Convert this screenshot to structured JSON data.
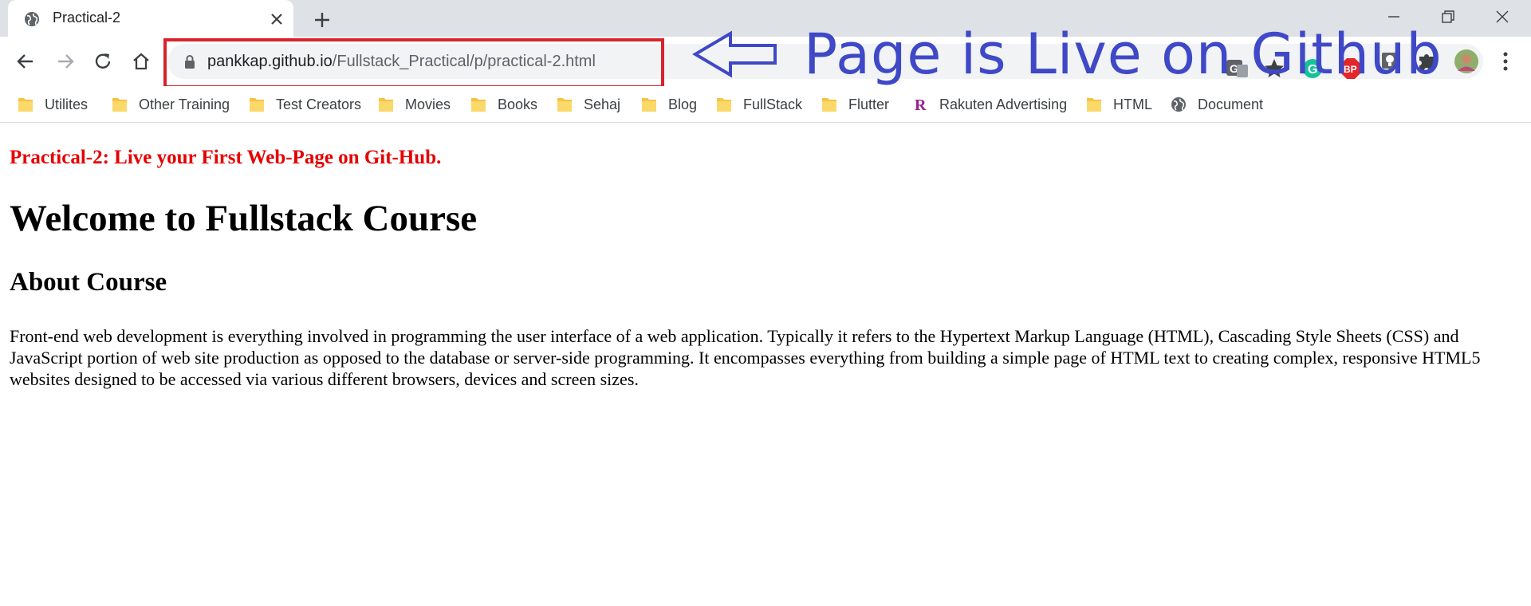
{
  "tab": {
    "title": "Practical-2"
  },
  "window": {
    "min_icon": "minimize-icon",
    "max_icon": "restore-icon",
    "close_icon": "close-icon"
  },
  "omnibox": {
    "host": "pankkap.github.io",
    "path": "/Fullstack_Practical/p/practical-2.html"
  },
  "annotation": {
    "text": "Page is Live on Github",
    "color": "#3f48c6",
    "box_color": "#d8232a"
  },
  "bookmarks": [
    {
      "label": "Utilites",
      "icon": "folder"
    },
    {
      "label": "Other Training",
      "icon": "folder"
    },
    {
      "label": "Test Creators",
      "icon": "folder"
    },
    {
      "label": "Movies",
      "icon": "folder"
    },
    {
      "label": "Books",
      "icon": "folder"
    },
    {
      "label": "Sehaj",
      "icon": "folder"
    },
    {
      "label": "Blog",
      "icon": "folder"
    },
    {
      "label": "FullStack",
      "icon": "folder"
    },
    {
      "label": "Flutter",
      "icon": "folder"
    },
    {
      "label": "Rakuten Advertising",
      "icon": "rakuten"
    },
    {
      "label": "HTML",
      "icon": "folder"
    },
    {
      "label": "Document",
      "icon": "globe"
    }
  ],
  "page": {
    "practical_title": "Practical-2: Live your First Web-Page on Git-Hub.",
    "heading": "Welcome to Fullstack Course",
    "subheading": "About Course",
    "paragraph": "Front-end web development is everything involved in programming the user interface of a web application. Typically it refers to the Hypertext Markup Language (HTML), Cascading Style Sheets (CSS) and JavaScript portion of web site production as opposed to the database or server-side programming. It encompasses everything from building a simple page of HTML text to creating complex, responsive HTML5 websites designed to be accessed via various different browsers, devices and screen sizes."
  },
  "colors": {
    "practical_title": "#e60000",
    "tabstrip": "#dee1e6"
  }
}
